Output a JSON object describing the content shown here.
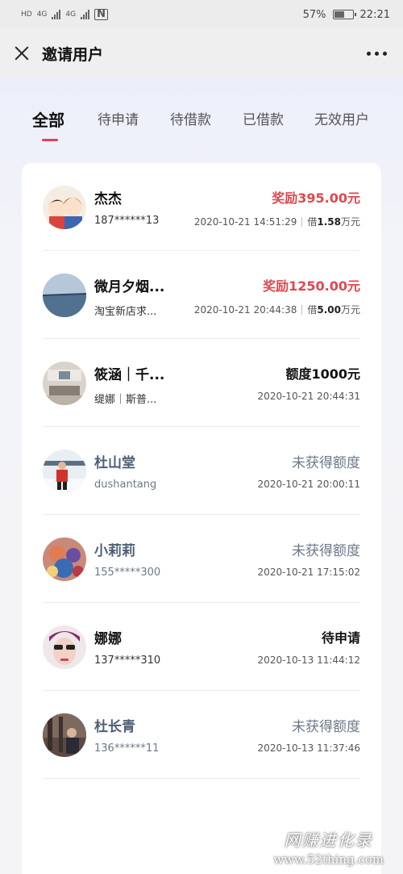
{
  "status_bar": {
    "left_labels": [
      "HD",
      "4G",
      "4G"
    ],
    "battery": "57%",
    "battery_level": 0.57,
    "time": "22:21"
  },
  "header": {
    "title": "邀请用户",
    "close_icon": "close-icon",
    "more_icon": "more-icon"
  },
  "tabs": [
    {
      "label": "全部",
      "active": true
    },
    {
      "label": "待申请",
      "active": false
    },
    {
      "label": "待借款",
      "active": false
    },
    {
      "label": "已借款",
      "active": false
    },
    {
      "label": "无效用户",
      "active": false
    }
  ],
  "colors": {
    "accent_red": "#e8404f",
    "reward_red": "#e0484f",
    "muted_blue_gray": "#6d7889"
  },
  "users": [
    {
      "name": "杰杰",
      "sub": "187******13",
      "status": "奖励395.00元",
      "status_style": "red",
      "time": "2020-10-21 14:51:29",
      "loan_prefix": "借",
      "loan_amount": "1.58",
      "loan_unit": "万元",
      "dim": false
    },
    {
      "name": "微月夕烟...",
      "sub": "淘宝新店求...",
      "status": "奖励1250.00元",
      "status_style": "red",
      "time": "2020-10-21 20:44:38",
      "loan_prefix": "借",
      "loan_amount": "5.00",
      "loan_unit": "万元",
      "dim": false
    },
    {
      "name": "筱涵｜千...",
      "sub": "缇娜｜斯普...",
      "status": "额度1000元",
      "status_style": "normal",
      "time": "2020-10-21 20:44:31",
      "dim": false
    },
    {
      "name": "杜山堂",
      "sub": "dushantang",
      "status": "未获得额度",
      "status_style": "gray",
      "time": "2020-10-21 20:00:11",
      "dim": true
    },
    {
      "name": "小莉莉",
      "sub": "155*****300",
      "status": "未获得额度",
      "status_style": "gray",
      "time": "2020-10-21 17:15:02",
      "dim": true
    },
    {
      "name": "娜娜",
      "sub": "137*****310",
      "status": "待申请",
      "status_style": "normal",
      "time": "2020-10-13 11:44:12",
      "dim": false
    },
    {
      "name": "杜长青",
      "sub": "136******11",
      "status": "未获得额度",
      "status_style": "gray",
      "time": "2020-10-13 11:37:46",
      "dim": true
    }
  ],
  "watermark": {
    "line1": "网赚进化录",
    "line2": "www.52thing.com"
  }
}
